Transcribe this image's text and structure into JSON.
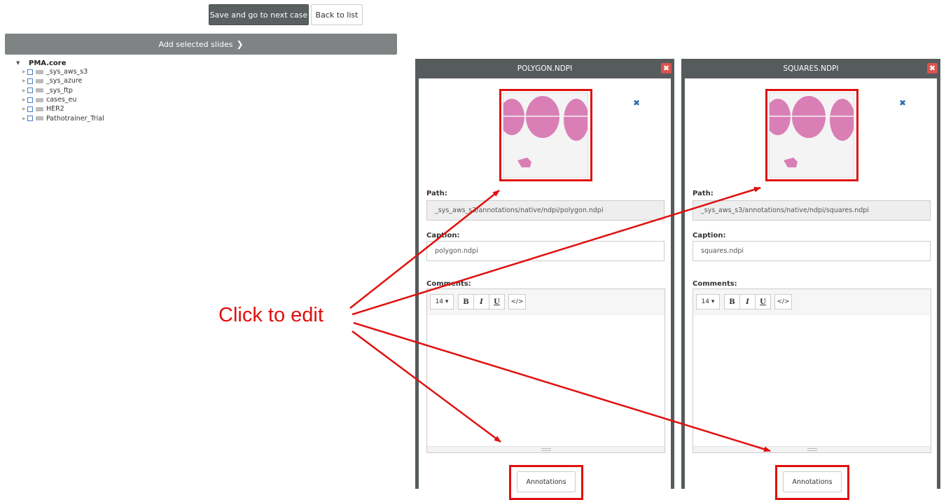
{
  "toolbar": {
    "save_label": "Save and go to next case",
    "back_label": "Back to list"
  },
  "add_bar": {
    "label": "Add selected slides",
    "icon": "chevron-right-icon"
  },
  "tree": {
    "root_label": "PMA.core",
    "items": [
      {
        "label": "_sys_aws_s3"
      },
      {
        "label": "_sys_azure"
      },
      {
        "label": "_sys_ftp"
      },
      {
        "label": "cases_eu"
      },
      {
        "label": "HER2"
      },
      {
        "label": "Pathotrainer_Trial"
      }
    ]
  },
  "panels": [
    {
      "title": "POLYGON.NDPI",
      "path_label": "Path:",
      "path_value": "_sys_aws_s3/annotations/native/ndpi/polygon.ndpi",
      "caption_label": "Caption:",
      "caption_value": "polygon.ndpi",
      "comments_label": "Comments:",
      "font_size": "14 ▾",
      "bold": "B",
      "italic": "I",
      "underline": "U",
      "code": "</>",
      "annotations_label": "Annotations"
    },
    {
      "title": "SQUARES.NDPI",
      "path_label": "Path:",
      "path_value": "_sys_aws_s3/annotations/native/ndpi/squares.ndpi",
      "caption_label": "Caption:",
      "caption_value": "squares.ndpi",
      "comments_label": "Comments:",
      "font_size": "14 ▾",
      "bold": "B",
      "italic": "I",
      "underline": "U",
      "code": "</>",
      "annotations_label": "Annotations"
    }
  ],
  "callout": {
    "text": "Click to edit",
    "color": "#e01010"
  },
  "colors": {
    "panel_header": "#565b5c",
    "close_button": "#d9534f",
    "primary_button": "#5a5f60",
    "tissue": "#d97fb6"
  }
}
